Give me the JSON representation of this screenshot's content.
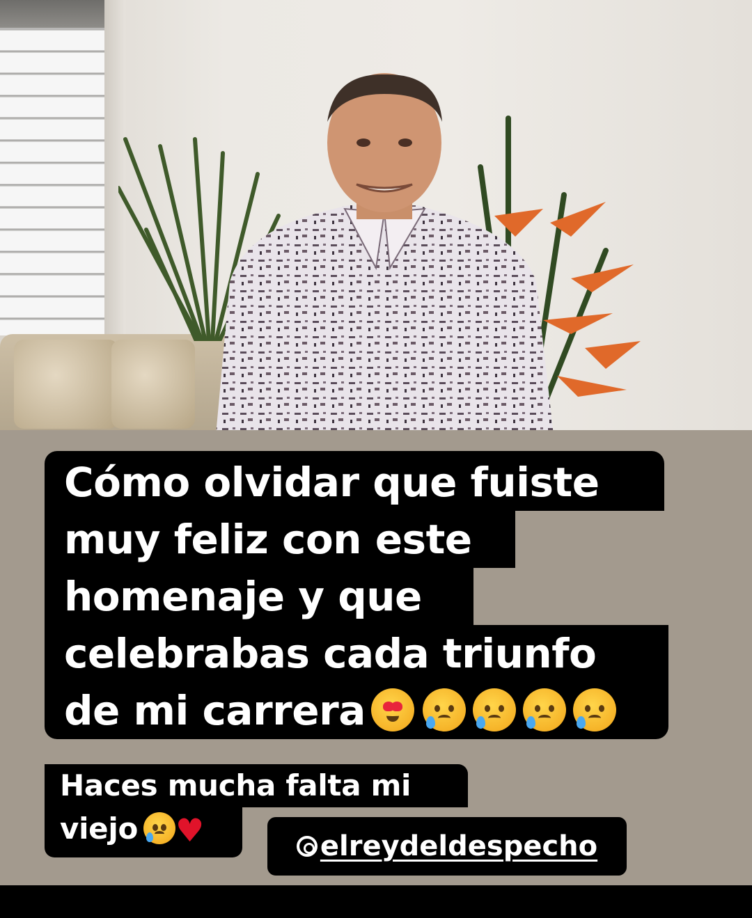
{
  "caption_main": {
    "lines": [
      "Cómo olvidar que fuiste",
      "muy feliz con este",
      "homenaje y que",
      "celebrabas cada triunfo",
      "de mi carrera"
    ]
  },
  "caption_second": {
    "lines": [
      "Haces mucha falta mi",
      "viejo"
    ]
  },
  "mention": {
    "handle": "@elreydeldespecho"
  },
  "emoji": {
    "line5": [
      "smiling-face-with-heart-eyes",
      "sad-relieved-face",
      "sad-relieved-face",
      "sad-relieved-face",
      "sad-relieved-face"
    ],
    "second_line2": [
      "sad-relieved-face",
      "red-heart"
    ]
  },
  "colors": {
    "story_background": "#a39a8e",
    "caption_background": "#000000",
    "caption_text": "#ffffff"
  }
}
